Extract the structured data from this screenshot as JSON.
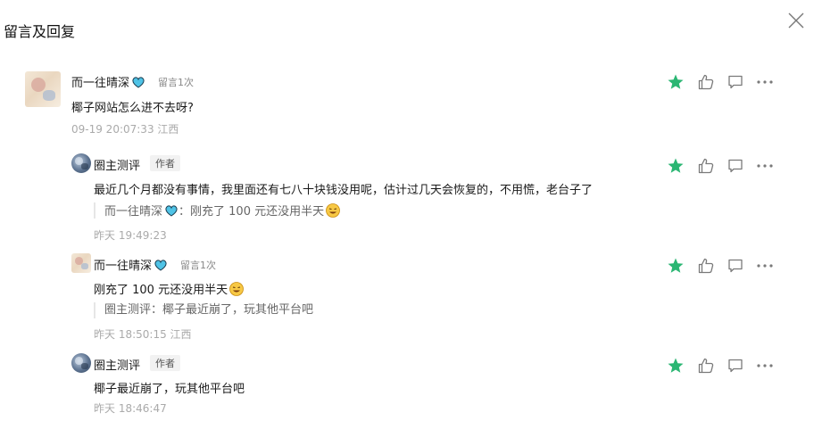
{
  "header": {
    "title": "留言及回复"
  },
  "comments": [
    {
      "nick": "而一往晴深",
      "count_label": "留言1次",
      "text": "椰子网站怎么进不去呀?",
      "meta": "09-19 20:07:33 江西",
      "starred": true
    },
    {
      "nick": "圈主测评",
      "author_label": "作者",
      "text": "最近几个月都没有事情，我里面还有七八十块钱没用呢，估计过几天会恢复的，不用慌，老台子了",
      "quote_nick": "而一往晴深",
      "quote_text": "：刚充了 100 元还没用半天",
      "meta": "昨天 19:49:23",
      "starred": true
    },
    {
      "nick": "而一往晴深",
      "count_label": "留言1次",
      "text": "刚充了 100 元还没用半天",
      "quote_text": "圈主测评：椰子最近崩了，玩其他平台吧",
      "meta": "昨天 18:50:15 江西",
      "starred": true
    },
    {
      "nick": "圈主测评",
      "author_label": "作者",
      "text": "椰子最近崩了，玩其他平台吧",
      "meta": "昨天 18:46:47",
      "starred": true
    }
  ],
  "colors": {
    "star": "#2bb673",
    "icon": "#7a7a7a",
    "meta": "#aaaaaa"
  },
  "icons": {
    "close": "close-icon",
    "star": "star-icon",
    "like": "thumb-up-icon",
    "reply": "reply-bubble-icon",
    "more": "more-icon",
    "heart_emoji": "blue-heart-emoji-icon",
    "smile": "grin-sweat-emoji-icon"
  }
}
